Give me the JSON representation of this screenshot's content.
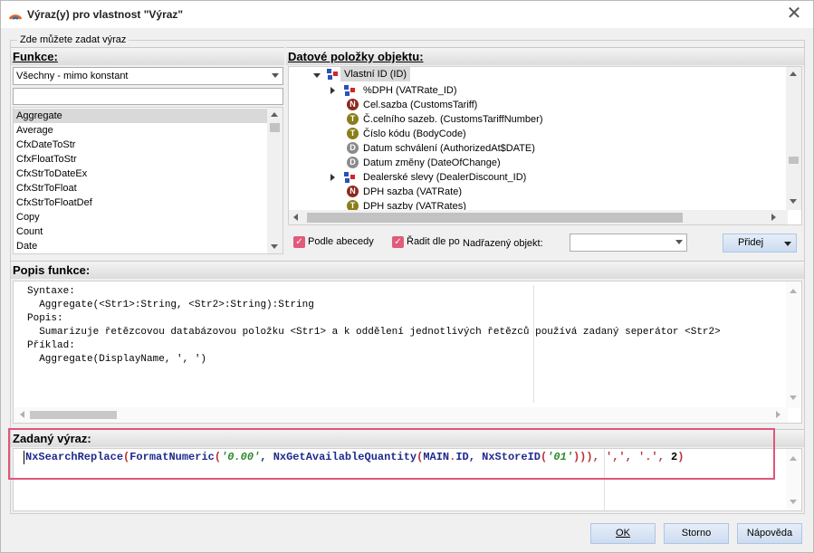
{
  "window": {
    "title": "Výraz(y) pro vlastnost \"Výraz\"",
    "close_glyph": "✕"
  },
  "group": {
    "legend": "Zde můžete zadat výraz"
  },
  "functions": {
    "header": "Funkce:",
    "filter_value": "Všechny - mimo konstant",
    "search_value": "",
    "items": [
      "Aggregate",
      "Average",
      "CfxDateToStr",
      "CfxFloatToStr",
      "CfxStrToDateEx",
      "CfxStrToFloat",
      "CfxStrToFloatDef",
      "Copy",
      "Count",
      "Date"
    ],
    "selected": "Aggregate"
  },
  "datafields": {
    "header": "Datové položky objektu:",
    "root": {
      "label": "Vlastní ID (ID)"
    },
    "items": [
      {
        "type": "rel",
        "label": "%DPH  (VATRate_ID)",
        "expandable": true
      },
      {
        "type": "N",
        "label": "Cel.sazba  (CustomsTariff)"
      },
      {
        "type": "T",
        "label": "Č.celního sazeb.  (CustomsTariffNumber)"
      },
      {
        "type": "T",
        "label": "Číslo kódu  (BodyCode)"
      },
      {
        "type": "D",
        "label": "Datum schválení  (AuthorizedAt$DATE)"
      },
      {
        "type": "D",
        "label": "Datum změny  (DateOfChange)"
      },
      {
        "type": "rel",
        "label": "Dealerské slevy  (DealerDiscount_ID)",
        "expandable": true
      },
      {
        "type": "N",
        "label": "DPH sazba  (VATRate)"
      },
      {
        "type": "T",
        "label": "DPH sazby  (VATRates)"
      }
    ],
    "sort_alpha_label": "Podle abecedy",
    "sort_by_label": "Řadit dle po",
    "parent_label": "Nadřazený objekt:",
    "parent_value": "",
    "add_button": "Přidej",
    "check_glyph": "✓"
  },
  "description": {
    "header": "Popis funkce:",
    "lines": [
      "Syntaxe:",
      "  Aggregate(<Str1>:String, <Str2>:String):String",
      "Popis:",
      "  Sumarizuje řetězcovou databázovou položku <Str1> a k oddělení jednotlivých řetězců používá zadaný seperátor <Str2>",
      "Příklad:",
      "  Aggregate(DisplayName, ', ')"
    ]
  },
  "expression": {
    "header": "Zadaný výraz:",
    "tokens": [
      {
        "t": "NxSearchReplace",
        "k": "fn"
      },
      {
        "t": "(",
        "k": "pun"
      },
      {
        "t": "FormatNumeric",
        "k": "fn"
      },
      {
        "t": "(",
        "k": "pun"
      },
      {
        "t": "'0.00'",
        "k": "str"
      },
      {
        "t": ", ",
        "k": "fn"
      },
      {
        "t": "NxGetAvailableQuantity",
        "k": "fn"
      },
      {
        "t": "(",
        "k": "pun"
      },
      {
        "t": "MAIN",
        "k": "fn"
      },
      {
        "t": ".",
        "k": "pun"
      },
      {
        "t": "ID",
        "k": "fn"
      },
      {
        "t": ", ",
        "k": "fn"
      },
      {
        "t": "NxStoreID",
        "k": "fn"
      },
      {
        "t": "(",
        "k": "pun"
      },
      {
        "t": "'01'",
        "k": "str"
      },
      {
        "t": "))), ",
        "k": "pun"
      },
      {
        "t": "','",
        "k": "pun"
      },
      {
        "t": ", ",
        "k": "pun"
      },
      {
        "t": "'.'",
        "k": "pun"
      },
      {
        "t": ", ",
        "k": "pun"
      },
      {
        "t": "2",
        "k": "num"
      },
      {
        "t": ")",
        "k": "pun"
      }
    ]
  },
  "footer": {
    "ok": "OK",
    "cancel": "Storno",
    "help": "Nápověda"
  },
  "colors": {
    "highlight": "#e0567a",
    "function": "#1f2a8c",
    "string": "#2d8a2d",
    "punctuation": "#b83232"
  }
}
